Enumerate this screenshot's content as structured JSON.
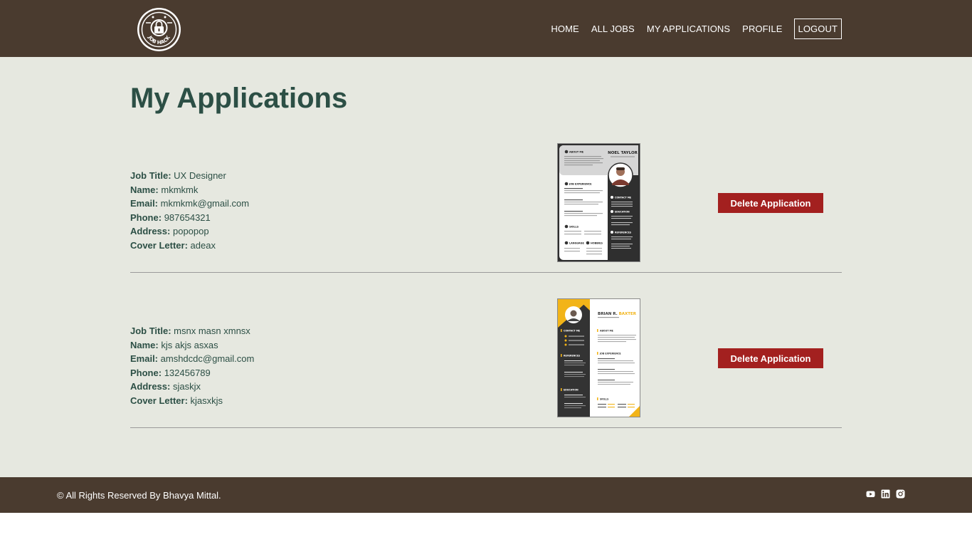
{
  "nav": {
    "logo_text": "JOB HACK",
    "items": [
      "HOME",
      "ALL JOBS",
      "MY APPLICATIONS",
      "PROFILE"
    ],
    "logout": "LOGOUT"
  },
  "page": {
    "title": "My Applications"
  },
  "labels": {
    "job_title": "Job Title:",
    "name": "Name:",
    "email": "Email:",
    "phone": "Phone:",
    "address": "Address:",
    "cover_letter": "Cover Letter:",
    "delete": "Delete Application"
  },
  "applications": [
    {
      "job_title": "UX Designer",
      "name": "mkmkmk",
      "email": "mkmkmk@gmail.com",
      "phone": "987654321",
      "address": "popopop",
      "cover_letter": "adeax",
      "resume": {
        "name": "NOEL TAYLOR",
        "sections": [
          "ABOUT ME",
          "JOB EXPERIENCE",
          "SKILLS",
          "LANGUAGE",
          "HOBBIES",
          "CONTACT ME",
          "EDUCATION",
          "REFERENCES"
        ]
      }
    },
    {
      "job_title": "msnx masn xmnsx",
      "name": "kjs akjs asxas",
      "email": "amshdcdc@gmail.com",
      "phone": "132456789",
      "address": "sjaskjx",
      "cover_letter": "kjasxkjs",
      "resume": {
        "name_first": "BRIAN R.",
        "name_last": "BAXTER",
        "sections": [
          "CONTACT ME",
          "REFERENCES",
          "EDUCATION",
          "ABOUT ME",
          "JOB EXPERIENCE",
          "SKILLS"
        ]
      }
    }
  ],
  "footer": {
    "copyright": "© All Rights Reserved By Bhavya Mittal.",
    "socials": [
      "youtube-icon",
      "linkedin-icon",
      "instagram-icon"
    ]
  },
  "colors": {
    "header_bg": "#4a3b2f",
    "main_bg": "#e6e8e0",
    "title": "#2c4f45",
    "button": "#a3201f",
    "accent_resume": "#f2b418"
  }
}
